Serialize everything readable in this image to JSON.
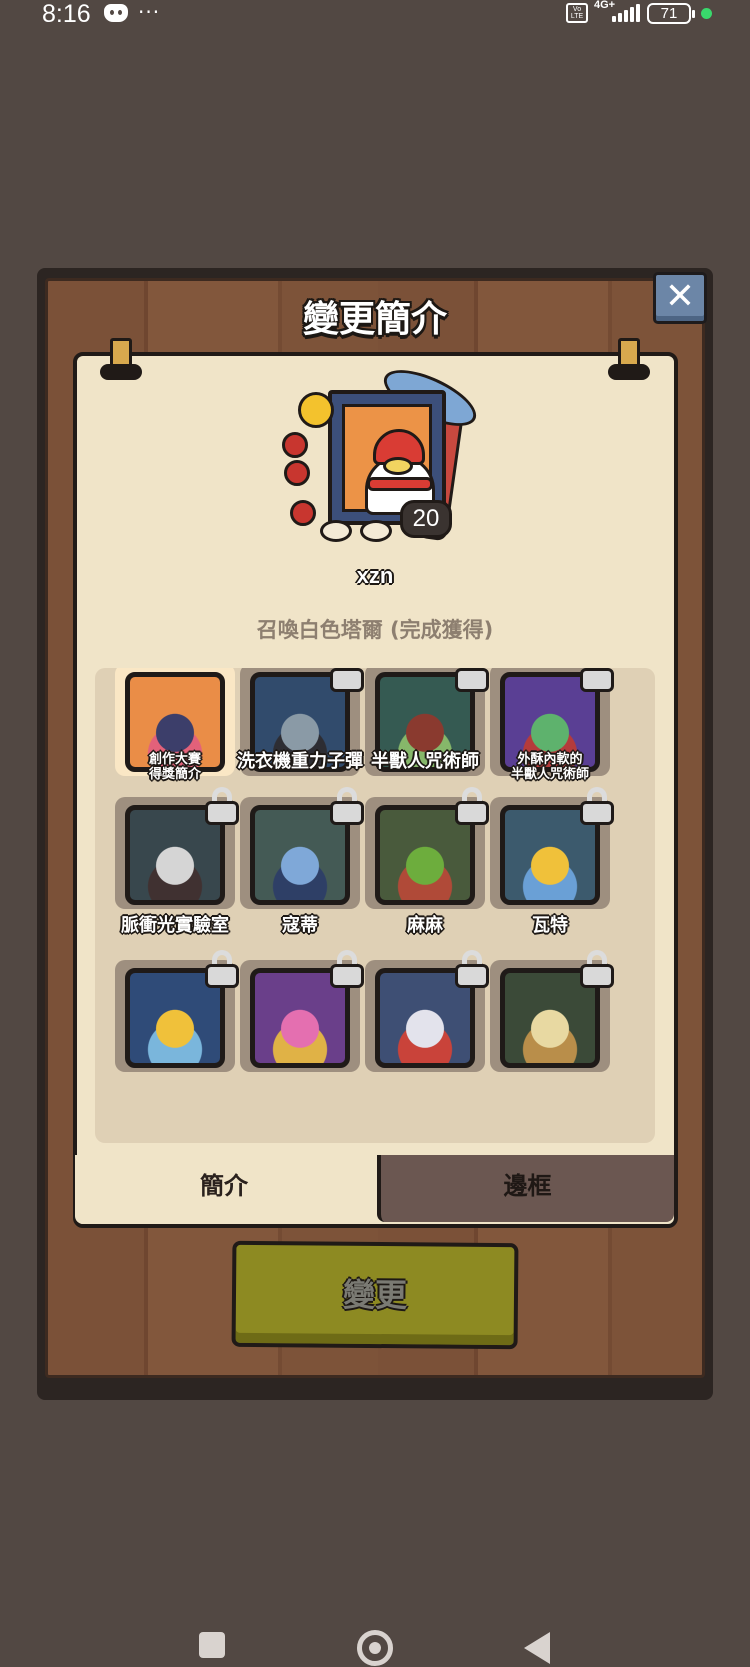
{
  "status_bar": {
    "time": "8:16",
    "dots": "···",
    "volte": "Vo LTE",
    "network": "4G+",
    "battery": "71",
    "icons": [
      "discord-icon",
      "signal-icon",
      "battery-icon",
      "green-dot-icon"
    ]
  },
  "dialog": {
    "title": "變更簡介",
    "close_icon": "✕"
  },
  "profile": {
    "username": "xzn",
    "level": "20",
    "description": "召喚白色塔爾 (完成獲得)"
  },
  "grid": {
    "items": [
      {
        "label": "創作大賽\n得獎簡介",
        "locked": false,
        "selected": true,
        "colors": [
          "#ea8d47",
          "#3c3e6a",
          "#e3617a"
        ]
      },
      {
        "label": "洗衣機重力子彈",
        "locked": true,
        "selected": false,
        "colors": [
          "#314b6c",
          "#8a9aa6",
          "#2d2d33"
        ]
      },
      {
        "label": "半獸人咒術師",
        "locked": true,
        "selected": false,
        "colors": [
          "#355a52",
          "#8a3a2f",
          "#86b76a"
        ]
      },
      {
        "label": "外酥內軟的\n半獸人咒術師",
        "locked": true,
        "selected": false,
        "colors": [
          "#5a3f94",
          "#5eb26d",
          "#b53b3b"
        ]
      },
      {
        "label": "脈衝光實驗室",
        "locked": true,
        "selected": false,
        "colors": [
          "#38474d",
          "#d5d5d5",
          "#403131"
        ]
      },
      {
        "label": "寇蒂",
        "locked": true,
        "selected": false,
        "colors": [
          "#445a55",
          "#7fa8d8",
          "#2e3f66"
        ]
      },
      {
        "label": "麻麻",
        "locked": true,
        "selected": false,
        "colors": [
          "#495a3c",
          "#6dad3d",
          "#b04a38"
        ]
      },
      {
        "label": "瓦特",
        "locked": true,
        "selected": false,
        "colors": [
          "#3c5a6d",
          "#f0c13a",
          "#6aa0d6"
        ]
      },
      {
        "label": "",
        "locked": true,
        "selected": false,
        "colors": [
          "#2f4b78",
          "#f0c13a",
          "#7ab6dc"
        ]
      },
      {
        "label": "",
        "locked": true,
        "selected": false,
        "colors": [
          "#6a3f8a",
          "#e46fb0",
          "#e0b246"
        ]
      },
      {
        "label": "",
        "locked": true,
        "selected": false,
        "colors": [
          "#3e4f74",
          "#e3e3ec",
          "#c9433a"
        ]
      },
      {
        "label": "",
        "locked": true,
        "selected": false,
        "colors": [
          "#3b4a38",
          "#e8d9a2",
          "#b98e4a"
        ]
      }
    ]
  },
  "tabs": {
    "profile": "簡介",
    "frame": "邊框"
  },
  "action": {
    "change": "變更"
  },
  "colors": {
    "background": "#524843",
    "paper": "#f0e4c8",
    "wood": "#7b5138",
    "close_button": "#6c86a7",
    "change_button": "#8d8a22",
    "selected_tile": "#fae7c5",
    "locked_tile": "#9e8f7f"
  }
}
